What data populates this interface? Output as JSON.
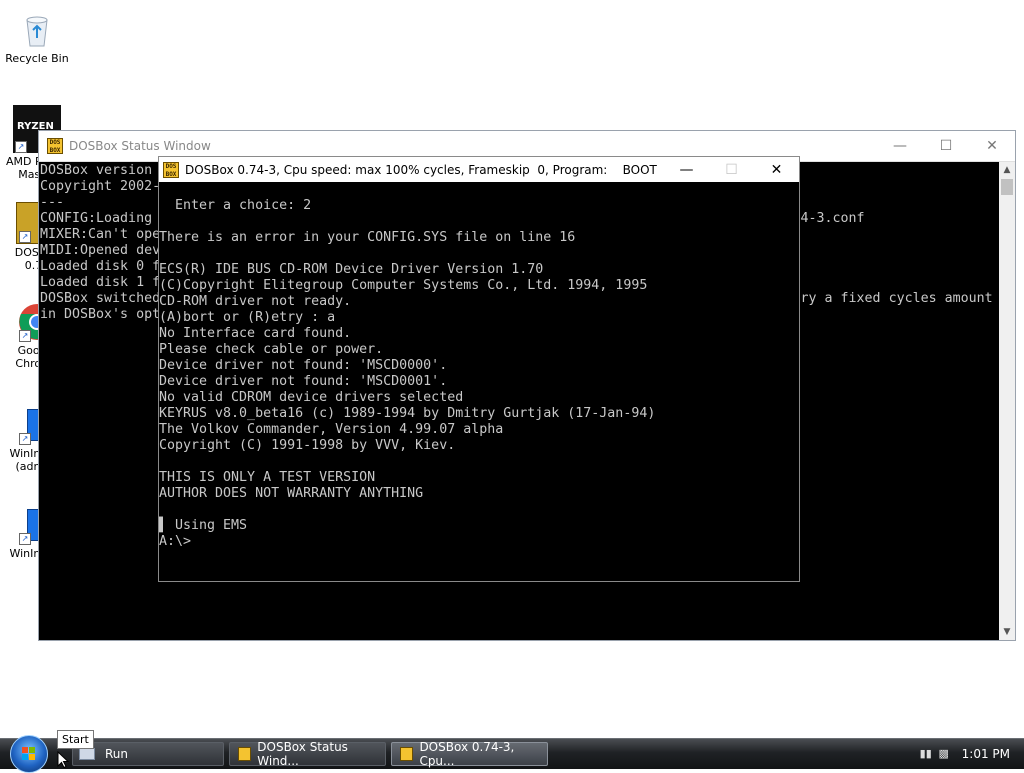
{
  "desktop": {
    "icons": [
      {
        "label": "Recycle Bin",
        "icon": "recycle-bin-icon"
      },
      {
        "label": "AMD Ryzen Master",
        "icon": "ryzen-icon"
      },
      {
        "label": "DOSBox 0.74",
        "icon": "dosbox-icon"
      },
      {
        "label": "Google Chrome",
        "icon": "chrome-icon"
      },
      {
        "label": "WinImage (admin)",
        "icon": "winimage-icon"
      },
      {
        "label": "WinImage",
        "icon": "winimage-icon"
      }
    ],
    "ryzen_text": "RYZEN"
  },
  "status_window": {
    "title": "DOSBox Status Window",
    "console": "DOSBox version 0.74-3\nCopyright 2002-2019 DOSBox Team, published under GNU GPL.\n---\nCONFIG:Loading primary settings from config file C:\\Users\\admin\\AppData\\Local\\DOSBox\\dosbox-0.74-3.conf\nMIXER:Can't open audio: No available audio device , running in nosound mode.\nMIDI:Opened device:win32\nLoaded disk 0 from swaplist position 0 - \"boot.img\"\nLoaded disk 1 from swaplist position 0 - \"boot.img\"\nDOSBox switched to max cycles, because of the setting: cycles=auto. If the game runs too fast try a fixed cycles amount\nin DOSBox's options."
  },
  "dos_window": {
    "title": "DOSBox 0.74-3, Cpu speed: max 100% cycles, Frameskip  0, Program:    BOOT",
    "console": "  Enter a choice: 2\n\nThere is an error in your CONFIG.SYS file on line 16\n\nECS(R) IDE BUS CD-ROM Device Driver Version 1.70\n(C)Copyright Elitegroup Computer Systems Co., Ltd. 1994, 1995\nCD-ROM driver not ready.\n(A)bort or (R)etry : a\nNo Interface card found.\nPlease check cable or power.\nDevice driver not found: 'MSCD0000'.\nDevice driver not found: 'MSCD0001'.\nNo valid CDROM device drivers selected\nKEYRUS v8.0_beta16 (c) 1989-1994 by Dmitry Gurtjak (17-Jan-94)\nThe Volkov Commander, Version 4.99.07 alpha\nCopyright (C) 1991-1998 by VVV, Kiev.\n\nTHIS IS ONLY A TEST VERSION\nAUTHOR DOES NOT WARRANTY ANYTHING\n\n▌ Using EMS\nA:\\>"
  },
  "taskbar": {
    "start_tooltip": "Start",
    "run_label": "Run",
    "buttons": [
      {
        "label": "DOSBox Status Wind..."
      },
      {
        "label": "DOSBox 0.74-3, Cpu..."
      }
    ],
    "clock": "1:01 PM"
  },
  "colors": {
    "console_text": "#c8c8c8",
    "console_bg": "#000000",
    "taskbar": "#1f2225"
  }
}
